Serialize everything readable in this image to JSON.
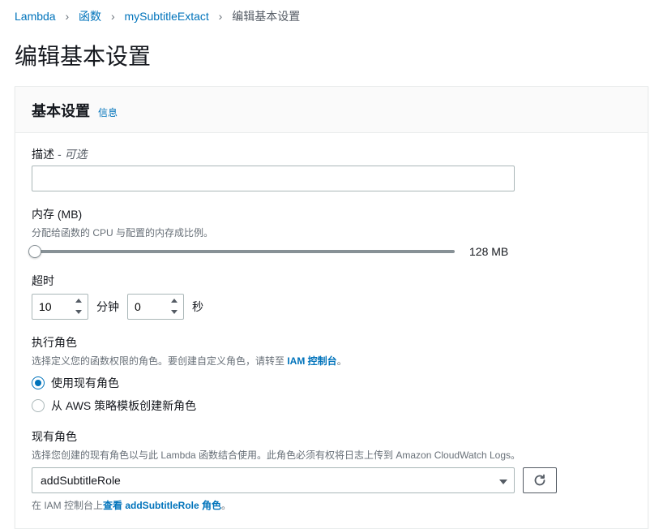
{
  "breadcrumb": {
    "lambda": "Lambda",
    "functions": "函数",
    "function_name": "mySubtitleExtact",
    "current": "编辑基本设置"
  },
  "page_title": "编辑基本设置",
  "panel": {
    "title": "基本设置",
    "info_link": "信息"
  },
  "description": {
    "label": "描述",
    "optional": " - 可选",
    "value": ""
  },
  "memory": {
    "label": "内存 (MB)",
    "hint": "分配给函数的 CPU 与配置的内存成比例。",
    "value": "128 MB"
  },
  "timeout": {
    "label": "超时",
    "minutes_value": "10",
    "minutes_unit": "分钟",
    "seconds_value": "0",
    "seconds_unit": "秒"
  },
  "execution_role": {
    "label": "执行角色",
    "hint_prefix": "选择定义您的函数权限的角色。要创建自定义角色，请转至 ",
    "hint_link": "IAM 控制台",
    "hint_suffix": "。",
    "option_existing": "使用现有角色",
    "option_template": "从 AWS 策略模板创建新角色"
  },
  "existing_role": {
    "label": "现有角色",
    "hint": "选择您创建的现有角色以与此 Lambda 函数结合使用。此角色必须有权将日志上传到 Amazon CloudWatch Logs。",
    "selected": "addSubtitleRole",
    "iam_prefix": "在 IAM 控制台上",
    "iam_link": "查看 addSubtitleRole 角色",
    "iam_suffix": "。"
  }
}
